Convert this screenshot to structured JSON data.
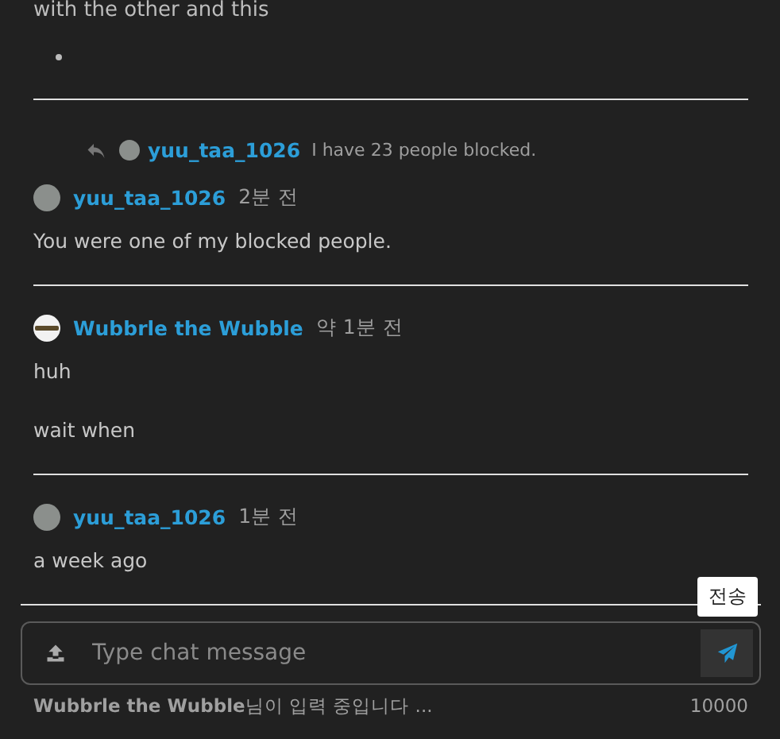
{
  "top_fragment": {
    "text": "with the other and this"
  },
  "messages": [
    {
      "author": "yuu_taa_1026",
      "kind": "person",
      "time": "2분 전",
      "reply": {
        "author": "yuu_taa_1026",
        "text": "I have 23 people blocked."
      },
      "lines": [
        "You were one of my blocked people."
      ]
    },
    {
      "author": "Wubbrle the Wubble",
      "kind": "rifle",
      "time": "약 1분 전",
      "lines": [
        "huh",
        "wait when"
      ]
    },
    {
      "author": "yuu_taa_1026",
      "kind": "person",
      "time": "1분 전",
      "lines": [
        "a week ago"
      ]
    }
  ],
  "composer": {
    "placeholder": "Type chat message",
    "send_tooltip": "전송",
    "typing": "**Wubbrle the Wubble**님이 입력 중입니다 ...",
    "char_limit": "10000"
  }
}
